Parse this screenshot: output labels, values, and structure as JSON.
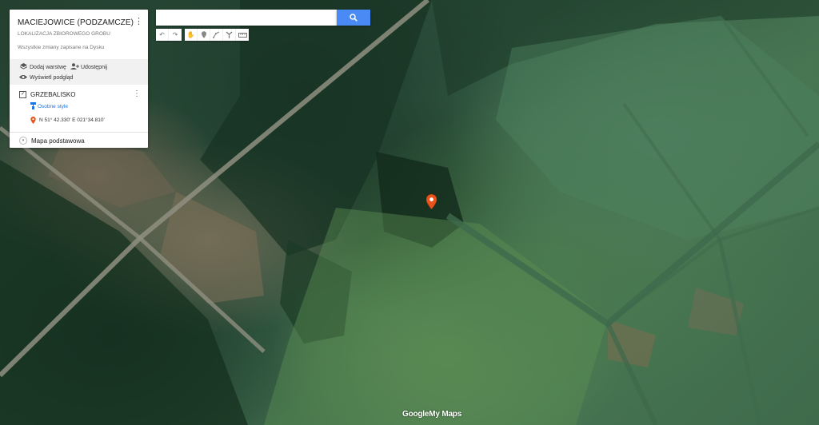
{
  "panel": {
    "title": "MACIEJOWICE (PODZAMCZE)",
    "subtitle": "LOKALIZACJA ZBIOROWEGO GROBU",
    "saved_status": "Wszystkie zmiany zapisane na Dysku",
    "menu_icon": "more-vert-icon",
    "actions": {
      "add_layer": "Dodaj warstwę",
      "share": "Udostępnij",
      "preview": "Wyświetl podgląd"
    },
    "layer": {
      "name": "GRZEBALISKO",
      "checked": true,
      "style_link": "Osobne style",
      "feature": "N 51° 42.330' E 021°34.810'"
    },
    "basemap": "Mapa podstawowa"
  },
  "search": {
    "value": "",
    "placeholder": ""
  },
  "toolbar": {
    "icons": [
      "undo-icon",
      "redo-icon",
      "hand-icon",
      "marker-icon",
      "draw-line-icon",
      "directions-icon",
      "ruler-icon"
    ]
  },
  "logo": {
    "part1": "Google",
    "part2": "My Maps"
  },
  "colors": {
    "accent": "#4a8af4",
    "marker": "#e8541c",
    "link": "#1a73e8"
  }
}
